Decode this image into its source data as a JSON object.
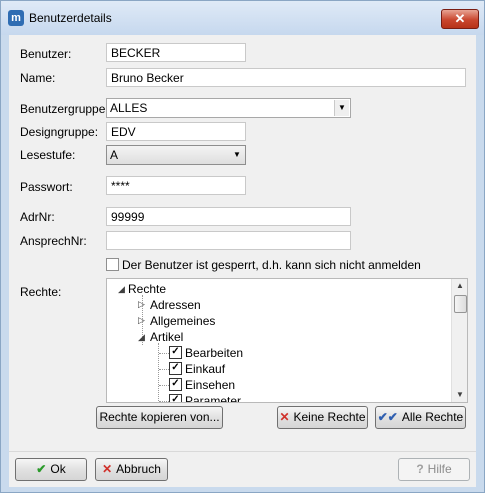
{
  "window": {
    "title": "Benutzerdetails",
    "app_icon": "m",
    "close_glyph": "✕"
  },
  "form": {
    "benutzer_label": "Benutzer:",
    "benutzer_value": "BECKER",
    "name_label": "Name:",
    "name_value": "Bruno Becker",
    "benutzergruppe_label": "Benutzergruppe",
    "benutzergruppe_value": "ALLES",
    "designgruppe_label": "Designgruppe:",
    "designgruppe_value": "EDV",
    "lesestufe_label": "Lesestufe:",
    "lesestufe_value": "A",
    "passwort_label": "Passwort:",
    "passwort_value": "****",
    "adrnr_label": "AdrNr:",
    "adrnr_value": "99999",
    "ansprechnr_label": "AnsprechNr:",
    "ansprechnr_value": "",
    "gesperrt_label": "Der Benutzer ist gesperrt, d.h. kann sich nicht anmelden",
    "gesperrt_checked": false,
    "rechte_label": "Rechte:"
  },
  "tree": {
    "root": "Rechte",
    "nodes": [
      {
        "label": "Adressen",
        "expanded": false
      },
      {
        "label": "Allgemeines",
        "expanded": false
      },
      {
        "label": "Artikel",
        "expanded": true
      }
    ],
    "artikel_children": [
      {
        "label": "Bearbeiten",
        "checked": true
      },
      {
        "label": "Einkauf",
        "checked": true
      },
      {
        "label": "Einsehen",
        "checked": true
      },
      {
        "label": "Parameter",
        "checked": true
      }
    ]
  },
  "buttons": {
    "rechte_kopieren": "Rechte kopieren von...",
    "keine_rechte": "Keine Rechte",
    "alle_rechte": "Alle Rechte",
    "ok": "Ok",
    "abbruch": "Abbruch",
    "hilfe": "Hilfe"
  },
  "icons": {
    "keine_rechte": "red-x-icon",
    "alle_rechte": "double-check-icon",
    "ok": "green-check-icon",
    "abbruch": "red-x-icon",
    "hilfe": "help-icon"
  },
  "colors": {
    "title_bg": "#c6d8ee",
    "close_red": "#c9462e",
    "ok_green": "#2a9a2a",
    "cancel_red": "#d0302a"
  }
}
